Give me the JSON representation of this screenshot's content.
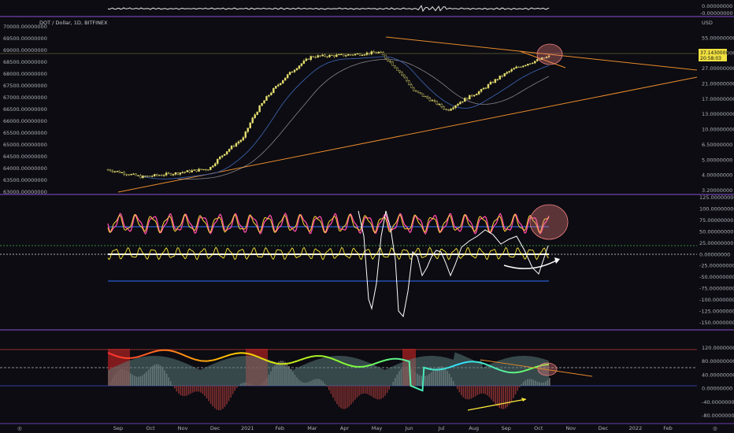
{
  "header": {
    "symbol_title": "DOT / Dollar, 1D, BITFINEX",
    "currency": "USD"
  },
  "colors": {
    "background": "#0c0c12",
    "separator": "#8a4fd8",
    "candle": "#e8e070",
    "trendline": "#e88a2c",
    "ma_fast": "#3b5fa8",
    "ma_slow": "#e0e0e0",
    "price_tag_bg": "#f0e040",
    "stoch_line": "#ff4aa8",
    "stoch_signal": "#ffd23a",
    "oscillator_blue": "#2f6fff",
    "oscillator_white": "#ffffff",
    "annotation_circle": "#f08080"
  },
  "price_tag": {
    "value": "37.14300000",
    "countdown": "20:58:03"
  },
  "time_axis": {
    "labels": [
      "Sep",
      "Oct",
      "Nov",
      "Dec",
      "2021",
      "Feb",
      "Mar",
      "Apr",
      "May",
      "Jun",
      "Jul",
      "Aug",
      "Sep",
      "Oct",
      "Nov",
      "Dec",
      "2022",
      "Feb"
    ]
  },
  "chart_data": [
    {
      "type": "line",
      "panel": "top-strip",
      "right_axis_ticks": [
        "0.00000000",
        "-0.00000000"
      ]
    },
    {
      "type": "line",
      "panel": "price",
      "title": "DOT / Dollar, 1D, BITFINEX",
      "left_axis_ticks": [
        "70000.00000000",
        "69500.00000000",
        "69000.00000000",
        "68500.00000000",
        "68000.00000000",
        "67500.00000000",
        "67000.00000000",
        "66500.00000000",
        "66000.00000000",
        "65500.00000000",
        "65000.00000000",
        "64500.00000000",
        "64000.00000000",
        "63500.00000000",
        "63000.00000000"
      ],
      "right_axis_ticks": [
        "USD",
        "55.00000000",
        "43.00000000",
        "27.00000000",
        "21.00000000",
        "17.00000000",
        "13.00000000",
        "10.00000000",
        "6.50000000",
        "5.00000000",
        "4.00000000",
        "3.20000000"
      ],
      "x": [
        "Sep",
        "Oct",
        "Nov",
        "Dec",
        "2021",
        "Feb",
        "Mar",
        "Apr",
        "May",
        "Jun",
        "Jul",
        "Aug",
        "Sep",
        "Oct"
      ],
      "series": [
        {
          "values": [
            4.8,
            4.2,
            4.5,
            4.9,
            8.5,
            22,
            37,
            38,
            40,
            20,
            14,
            20,
            30,
            37
          ]
        }
      ]
    },
    {
      "type": "line",
      "panel": "oscillator",
      "right_axis_ticks": [
        "125.00000000",
        "100.00000000",
        "75.00000000",
        "50.00000000",
        "25.00000000",
        "0.00000000",
        "-25.00000000",
        "-50.00000000",
        "-75.00000000",
        "-100.00000000",
        "-125.00000000",
        "-150.00000000"
      ],
      "levels": [
        62,
        12,
        0,
        -60
      ]
    },
    {
      "type": "area",
      "panel": "momentum",
      "right_axis_ticks": [
        "120.00000000",
        "80.00000000",
        "40.00000000",
        "0.00000000",
        "-40.00000000",
        "-80.00000000"
      ],
      "levels": [
        100,
        50,
        0
      ]
    }
  ]
}
